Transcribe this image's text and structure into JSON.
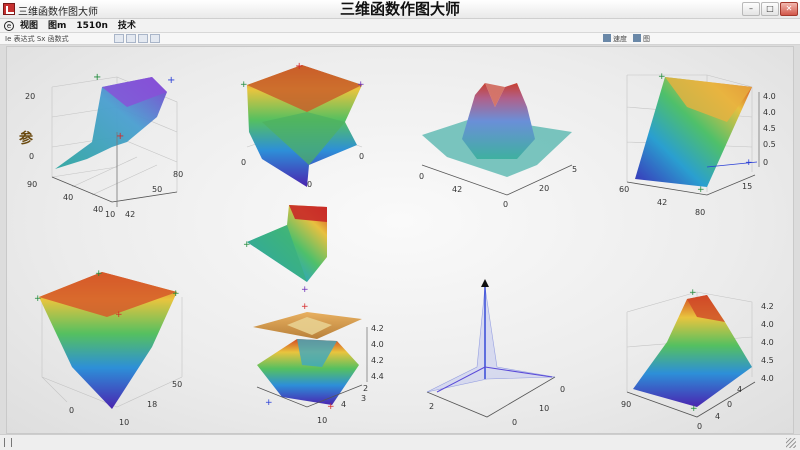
{
  "window": {
    "title_small": "三维函数作图大师",
    "title_main": "三维函数作图大师",
    "controls": [
      "–",
      "□",
      "✕"
    ]
  },
  "menu": {
    "logo": "e",
    "items": [
      "视图",
      "图m",
      "1510n",
      "技术"
    ]
  },
  "toolbar": {
    "status": "Ie 表达式 Sx 函数式",
    "right_items": [
      "速度",
      "图"
    ]
  },
  "colors": {
    "accent_red": "#d62828",
    "accent_green": "#1f8a3a",
    "accent_blue": "#2a3fd6",
    "accent_purple": "#6a2ab8"
  },
  "plots": [
    {
      "name": "plot-1",
      "ticks": [
        "20",
        "0",
        "40",
        "90",
        "40",
        "10",
        "80",
        "50",
        "42"
      ],
      "label": "参"
    },
    {
      "name": "plot-2",
      "ticks": [
        "0",
        "0",
        "0"
      ]
    },
    {
      "name": "plot-3",
      "ticks": [
        "0",
        "42",
        "0",
        "20",
        "5"
      ]
    },
    {
      "name": "plot-4",
      "ticks": [
        "4.0",
        "4.0",
        "4.5",
        "0.5",
        "60",
        "42",
        "15",
        "80",
        "0"
      ]
    },
    {
      "name": "plot-5",
      "ticks": []
    },
    {
      "name": "plot-6",
      "ticks": [
        "0",
        "10",
        "18",
        "50"
      ]
    },
    {
      "name": "plot-7",
      "ticks": [
        "4.2",
        "4.0",
        "4.2",
        "4.4",
        "2",
        "4",
        "10",
        "3"
      ]
    },
    {
      "name": "plot-8",
      "ticks": [
        "2",
        "0",
        "0",
        "10"
      ]
    },
    {
      "name": "plot-9",
      "ticks": [
        "4.2",
        "4.0",
        "4.0",
        "4.5",
        "4.0",
        "90",
        "4",
        "0",
        "4",
        "0"
      ]
    }
  ]
}
